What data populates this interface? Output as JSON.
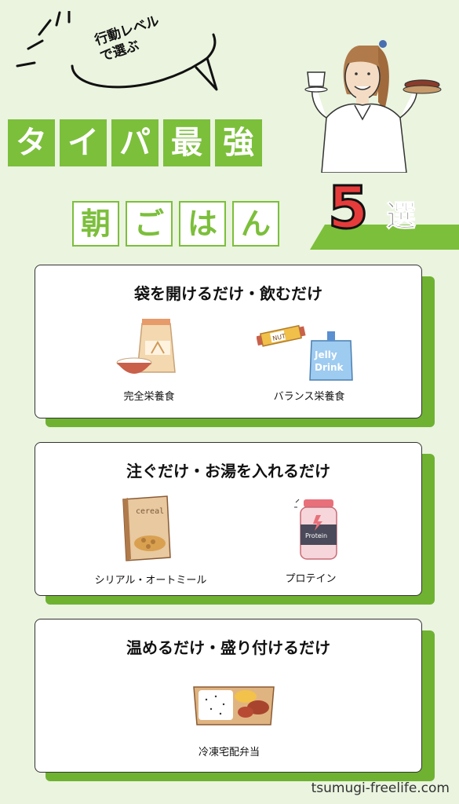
{
  "bubble": {
    "text": "行動レベル\nで選ぶ"
  },
  "title": {
    "line1_chars": [
      "タ",
      "イ",
      "パ",
      "最",
      "強"
    ],
    "line2_chars": [
      "朝",
      "ご",
      "は",
      "ん"
    ],
    "number": "5",
    "suffix": "選"
  },
  "sections": [
    {
      "heading": "袋を開けるだけ・飲むだけ",
      "items": [
        {
          "label": "完全栄養食",
          "icon": "flour-bag-icon"
        },
        {
          "label": "バランス栄養食",
          "icon": "nut-bar-jelly-icon"
        }
      ]
    },
    {
      "heading": "注ぐだけ・お湯を入れるだけ",
      "items": [
        {
          "label": "シリアル・オートミール",
          "icon": "cereal-box-icon"
        },
        {
          "label": "プロテイン",
          "icon": "protein-tub-icon"
        }
      ]
    },
    {
      "heading": "温めるだけ・盛り付けるだけ",
      "items": [
        {
          "label": "冷凍宅配弁当",
          "icon": "bento-box-icon"
        }
      ]
    }
  ],
  "footer": {
    "site": "tsumugi-freelife.com"
  },
  "colors": {
    "background": "#eaf4df",
    "accent_green": "#7cbf3b",
    "number_red": "#e63b3b"
  }
}
